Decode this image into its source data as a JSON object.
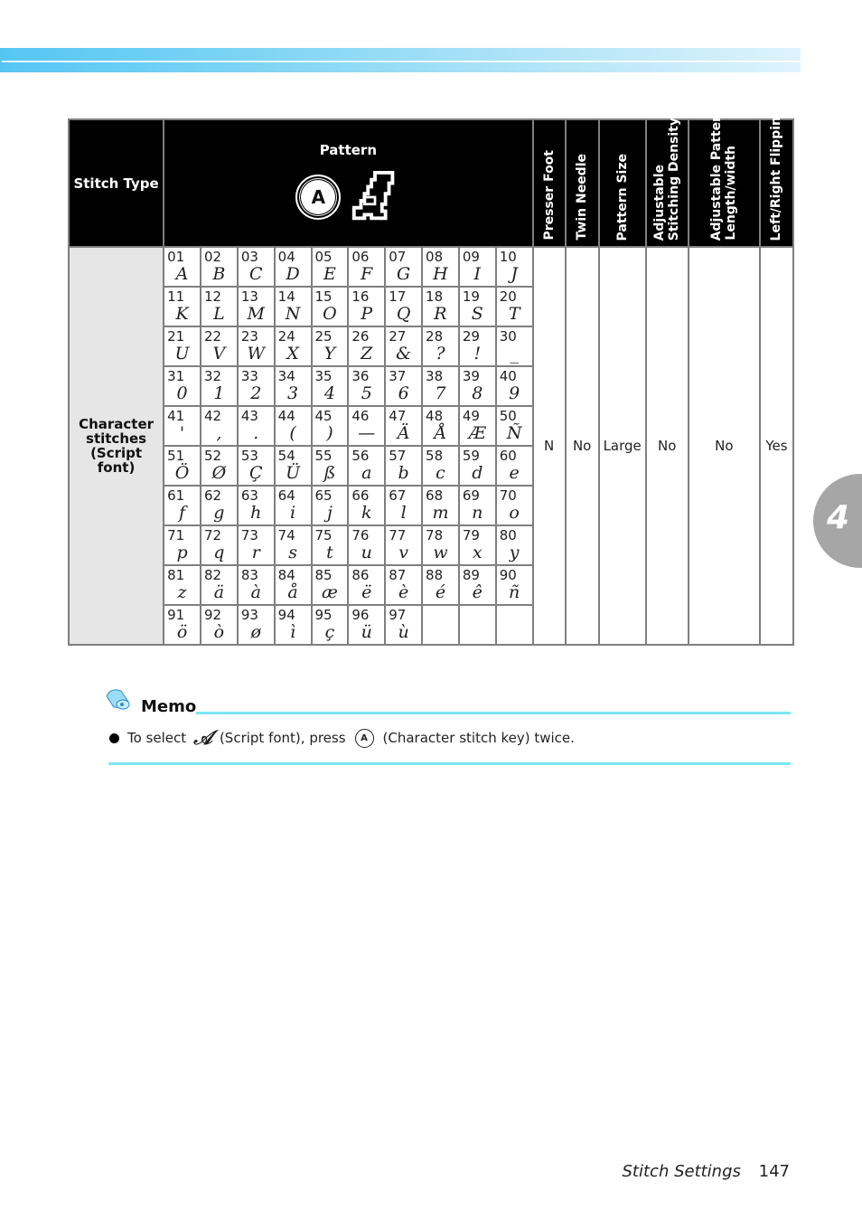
{
  "header": {
    "stitch_type": "Stitch Type",
    "pattern": "Pattern",
    "key_label": "A",
    "script_font_glyph": "𝒜",
    "columns": [
      "Presser Foot",
      "Twin Needle",
      "Pattern Size",
      "Adjustable Stitching Density",
      "Adjustable Pattern Length/width",
      "Left/Right Flipping"
    ],
    "column_lines": [
      [
        "Presser Foot"
      ],
      [
        "Twin Needle"
      ],
      [
        "Pattern Size"
      ],
      [
        "Adjustable",
        "Stitching Density"
      ],
      [
        "Adjustable Pattern",
        "Length/width"
      ],
      [
        "Left/Right Flipping"
      ]
    ]
  },
  "row": {
    "type_lines": [
      "Character",
      "stitches",
      "(Script font)"
    ],
    "presser_foot": "N",
    "twin_needle": "No",
    "pattern_size": "Large",
    "stitching_density": "No",
    "length_width": "No",
    "flipping": "Yes"
  },
  "patterns": [
    {
      "num": "01",
      "glyph": "A"
    },
    {
      "num": "02",
      "glyph": "B"
    },
    {
      "num": "03",
      "glyph": "C"
    },
    {
      "num": "04",
      "glyph": "D"
    },
    {
      "num": "05",
      "glyph": "E"
    },
    {
      "num": "06",
      "glyph": "F"
    },
    {
      "num": "07",
      "glyph": "G"
    },
    {
      "num": "08",
      "glyph": "H"
    },
    {
      "num": "09",
      "glyph": "I"
    },
    {
      "num": "10",
      "glyph": "J"
    },
    {
      "num": "11",
      "glyph": "K"
    },
    {
      "num": "12",
      "glyph": "L"
    },
    {
      "num": "13",
      "glyph": "M"
    },
    {
      "num": "14",
      "glyph": "N"
    },
    {
      "num": "15",
      "glyph": "O"
    },
    {
      "num": "16",
      "glyph": "P"
    },
    {
      "num": "17",
      "glyph": "Q"
    },
    {
      "num": "18",
      "glyph": "R"
    },
    {
      "num": "19",
      "glyph": "S"
    },
    {
      "num": "20",
      "glyph": "T"
    },
    {
      "num": "21",
      "glyph": "U"
    },
    {
      "num": "22",
      "glyph": "V"
    },
    {
      "num": "23",
      "glyph": "W"
    },
    {
      "num": "24",
      "glyph": "X"
    },
    {
      "num": "25",
      "glyph": "Y"
    },
    {
      "num": "26",
      "glyph": "Z"
    },
    {
      "num": "27",
      "glyph": "&"
    },
    {
      "num": "28",
      "glyph": "?"
    },
    {
      "num": "29",
      "glyph": "!"
    },
    {
      "num": "30",
      "glyph": "_"
    },
    {
      "num": "31",
      "glyph": "0"
    },
    {
      "num": "32",
      "glyph": "1"
    },
    {
      "num": "33",
      "glyph": "2"
    },
    {
      "num": "34",
      "glyph": "3"
    },
    {
      "num": "35",
      "glyph": "4"
    },
    {
      "num": "36",
      "glyph": "5"
    },
    {
      "num": "37",
      "glyph": "6"
    },
    {
      "num": "38",
      "glyph": "7"
    },
    {
      "num": "39",
      "glyph": "8"
    },
    {
      "num": "40",
      "glyph": "9"
    },
    {
      "num": "41",
      "glyph": "'"
    },
    {
      "num": "42",
      "glyph": ","
    },
    {
      "num": "43",
      "glyph": "."
    },
    {
      "num": "44",
      "glyph": "("
    },
    {
      "num": "45",
      "glyph": ")"
    },
    {
      "num": "46",
      "glyph": "—"
    },
    {
      "num": "47",
      "glyph": "Ä"
    },
    {
      "num": "48",
      "glyph": "Å"
    },
    {
      "num": "49",
      "glyph": "Æ"
    },
    {
      "num": "50",
      "glyph": "Ñ"
    },
    {
      "num": "51",
      "glyph": "Ö"
    },
    {
      "num": "52",
      "glyph": "Ø"
    },
    {
      "num": "53",
      "glyph": "Ç"
    },
    {
      "num": "54",
      "glyph": "Ü"
    },
    {
      "num": "55",
      "glyph": "ß"
    },
    {
      "num": "56",
      "glyph": "a"
    },
    {
      "num": "57",
      "glyph": "b"
    },
    {
      "num": "58",
      "glyph": "c"
    },
    {
      "num": "59",
      "glyph": "d"
    },
    {
      "num": "60",
      "glyph": "e"
    },
    {
      "num": "61",
      "glyph": "f"
    },
    {
      "num": "62",
      "glyph": "g"
    },
    {
      "num": "63",
      "glyph": "h"
    },
    {
      "num": "64",
      "glyph": "i"
    },
    {
      "num": "65",
      "glyph": "j"
    },
    {
      "num": "66",
      "glyph": "k"
    },
    {
      "num": "67",
      "glyph": "l"
    },
    {
      "num": "68",
      "glyph": "m"
    },
    {
      "num": "69",
      "glyph": "n"
    },
    {
      "num": "70",
      "glyph": "o"
    },
    {
      "num": "71",
      "glyph": "p"
    },
    {
      "num": "72",
      "glyph": "q"
    },
    {
      "num": "73",
      "glyph": "r"
    },
    {
      "num": "74",
      "glyph": "s"
    },
    {
      "num": "75",
      "glyph": "t"
    },
    {
      "num": "76",
      "glyph": "u"
    },
    {
      "num": "77",
      "glyph": "v"
    },
    {
      "num": "78",
      "glyph": "w"
    },
    {
      "num": "79",
      "glyph": "x"
    },
    {
      "num": "80",
      "glyph": "y"
    },
    {
      "num": "81",
      "glyph": "z"
    },
    {
      "num": "82",
      "glyph": "ä"
    },
    {
      "num": "83",
      "glyph": "à"
    },
    {
      "num": "84",
      "glyph": "å"
    },
    {
      "num": "85",
      "glyph": "æ"
    },
    {
      "num": "86",
      "glyph": "ë"
    },
    {
      "num": "87",
      "glyph": "è"
    },
    {
      "num": "88",
      "glyph": "é"
    },
    {
      "num": "89",
      "glyph": "ê"
    },
    {
      "num": "90",
      "glyph": "ñ"
    },
    {
      "num": "91",
      "glyph": "ö"
    },
    {
      "num": "92",
      "glyph": "ò"
    },
    {
      "num": "93",
      "glyph": "ø"
    },
    {
      "num": "94",
      "glyph": "ì"
    },
    {
      "num": "95",
      "glyph": "ç"
    },
    {
      "num": "96",
      "glyph": "ü"
    },
    {
      "num": "97",
      "glyph": "ù"
    },
    {
      "num": "",
      "glyph": ""
    },
    {
      "num": "",
      "glyph": ""
    },
    {
      "num": "",
      "glyph": ""
    }
  ],
  "memo": {
    "title": "Memo",
    "text_before": "To select",
    "script_glyph": "𝒜",
    "text_middle": "(Script font), press",
    "key_label": "A",
    "text_after": "(Character stitch key) twice."
  },
  "chapter": {
    "number": "4"
  },
  "footer": {
    "section": "Stitch Settings",
    "page": "147"
  },
  "colors": {
    "band_start": "#55c6f3",
    "band_end": "#def3fc",
    "memo_rule": "#7ee6f3",
    "chapter_tab": "#a6a6a6",
    "type_cell_bg": "#e6e6e6"
  }
}
